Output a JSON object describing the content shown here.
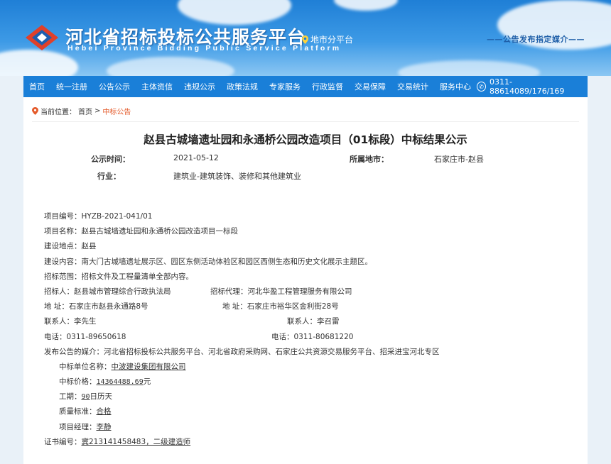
{
  "header": {
    "site_title": "河北省招标投标公共服务平台",
    "site_subtitle": "Hebei Province Bidding Public Service Platform",
    "city_platform": "地市分平台",
    "slogan": "——公告发布指定媒介——",
    "brand_color": "#1a7fd8"
  },
  "nav": {
    "items": [
      "首页",
      "统一注册",
      "公告公示",
      "主体资信",
      "违规公示",
      "政策法规",
      "专家服务",
      "行政监督",
      "交易保障",
      "交易统计",
      "服务中心"
    ],
    "phone": "0311-88614089/176/169"
  },
  "breadcrumb": {
    "prefix": "当前位置：",
    "home": "首页",
    "sep": ">",
    "current": "中标公告"
  },
  "notice": {
    "title": "赵县古城墙遗址园和永通桥公园改造项目（01标段）中标结果公示",
    "publish_time_label": "公示时间：",
    "publish_time": "2021-05-12",
    "city_label": "所属地市：",
    "city": "石家庄市-赵县",
    "industry_label": "行业：",
    "industry": "建筑业-建筑装饰、装修和其他建筑业"
  },
  "content": {
    "project_no": "项目编号：HYZB-2021-041/01",
    "project_name": "项目名称：赵县古城墙遗址园和永通桥公园改造项目一标段",
    "location": "建设地点：赵县",
    "scope_content": "建设内容：南大门古城墙遗址展示区、园区东侧活动体验区和园区西侧生态和历史文化展示主题区。",
    "bid_scope": "招标范围：招标文件及工程量清单全部内容。",
    "tenderer": "招标人：赵县城市管理综合行政执法局",
    "agent": "招标代理：河北华盈工程管理服务有限公司",
    "tenderer_addr": "地  址：石家庄市赵县永通路8号",
    "agent_addr": "地  址：石家庄市裕华区金利街28号",
    "tenderer_contact": "联系人：李先生",
    "agent_contact": "联系人：李召雷",
    "tenderer_phone": "电话：0311-89650618",
    "agent_phone": "电话：0311-80681220",
    "media": "发布公告的媒介：河北省招标投标公共服务平台、河北省政府采购网、石家庄公共资源交易服务平台、招采进宝河北专区",
    "winner_label": "中标单位名称：",
    "winner": "中波建设集团有限公司",
    "price_label": "中标价格：",
    "price": "14364488.69",
    "price_unit": "元",
    "period_label": "工期：",
    "period": "90",
    "period_unit": "日历天",
    "quality_label": "质量标准：",
    "quality": "合格",
    "manager_label": "项目经理：",
    "manager": "李静",
    "cert_label": "证书编号：",
    "cert": "冀213141458483，二级建造师"
  }
}
